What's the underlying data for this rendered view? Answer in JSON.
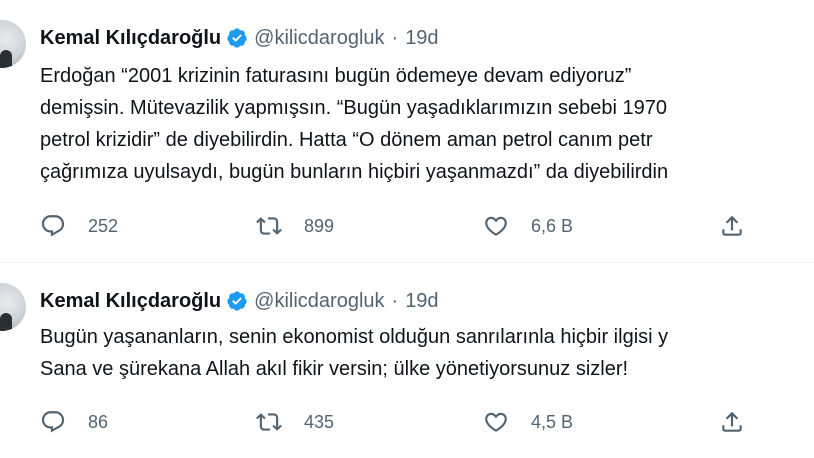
{
  "tweets": [
    {
      "author_name": "Kemal Kılıçdaroğlu",
      "handle": "@kilicdarogluk",
      "separator": "·",
      "time": "19d",
      "lines": [
        "Erdoğan “2001 krizinin faturasını bugün ödemeye devam ediyoruz”",
        "demişsin. Mütevazilik yapmışsın. “Bugün yaşadıklarımızın sebebi 1970",
        "petrol krizidir” de diyebilirdin. Hatta “O dönem aman petrol canım petr",
        "çağrımıza uyulsaydı, bugün bunların hiçbiri yaşanmazdı” da diyebilirdin"
      ],
      "replies": "252",
      "retweets": "899",
      "likes": "6,6 B"
    },
    {
      "author_name": "Kemal Kılıçdaroğlu",
      "handle": "@kilicdarogluk",
      "separator": "·",
      "time": "19d",
      "lines": [
        "Bugün yaşananların, senin ekonomist olduğun sanrılarınla hiçbir ilgisi y",
        "Sana ve şürekana Allah akıl fikir versin; ülke yönetiyorsunuz sizler!"
      ],
      "replies": "86",
      "retweets": "435",
      "likes": "4,5 B"
    }
  ],
  "icons": {
    "reply": "reply-icon",
    "retweet": "retweet-icon",
    "like": "heart-icon",
    "share": "share-icon",
    "verified": "verified-badge-icon"
  },
  "colors": {
    "text": "#0f1419",
    "secondary": "#536471",
    "verified": "#1d9bf0",
    "divider": "#eff3f4"
  }
}
